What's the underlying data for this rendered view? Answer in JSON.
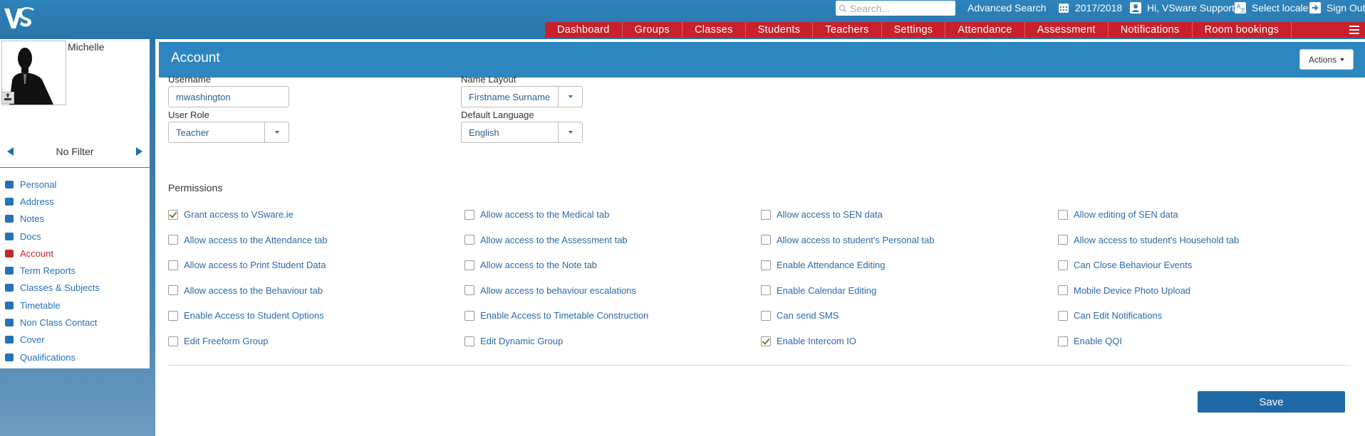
{
  "header": {
    "logo_text": "VS",
    "search_placeholder": "Search...",
    "advanced_search": "Advanced Search",
    "year": "2017/2018",
    "greeting": "Hi, VSware Support",
    "select_locale": "Select locale",
    "sign_out": "Sign Out"
  },
  "nav": [
    "Dashboard",
    "Groups",
    "Classes",
    "Students",
    "Teachers",
    "Settings",
    "Attendance",
    "Assessment",
    "Notifications",
    "Room bookings"
  ],
  "student": {
    "name": "Michelle"
  },
  "filter": {
    "label": "No Filter"
  },
  "sidebar": {
    "items": [
      {
        "label": "Personal",
        "icon": "person-icon"
      },
      {
        "label": "Address",
        "icon": "home-icon"
      },
      {
        "label": "Notes",
        "icon": "edit-icon"
      },
      {
        "label": "Docs",
        "icon": "file-icon"
      },
      {
        "label": "Account",
        "icon": "person-icon"
      },
      {
        "label": "Term Reports",
        "icon": "chart-icon"
      },
      {
        "label": "Classes & Subjects",
        "icon": "group-icon"
      },
      {
        "label": "Timetable",
        "icon": "calendar-icon"
      },
      {
        "label": "Non Class Contact",
        "icon": "calendar-icon"
      },
      {
        "label": "Cover",
        "icon": "person-icon"
      },
      {
        "label": "Qualifications",
        "icon": "file-icon"
      }
    ]
  },
  "account": {
    "title": "Account",
    "actions_label": "Actions",
    "username_label": "Username",
    "username_value": "mwashington",
    "name_layout_label": "Name Layout",
    "name_layout_value": "Firstname Surname",
    "user_role_label": "User Role",
    "user_role_value": "Teacher",
    "default_language_label": "Default Language",
    "default_language_value": "English",
    "permissions_label": "Permissions",
    "save_label": "Save"
  },
  "permissions": [
    [
      "Grant access to VSware.ie",
      "Allow access to the Medical tab",
      "Allow access to SEN data",
      "Allow editing of SEN data"
    ],
    [
      "Allow access to the Attendance tab",
      "Allow access to the Assessment tab",
      "Allow access to student's Personal tab",
      "Allow access to student's Household tab"
    ],
    [
      "Allow access to Print Student Data",
      "Allow access to the Note tab",
      "Enable Attendance Editing",
      "Can Close Behaviour Events"
    ],
    [
      "Allow access to the Behaviour tab",
      "Allow access to behaviour escalations",
      "Enable Calendar Editing",
      "Mobile Device Photo Upload"
    ],
    [
      "Enable Access to Student Options",
      "Enable Access to Timetable Construction",
      "Can send SMS",
      "Can Edit Notifications"
    ],
    [
      "Edit Freeform Group",
      "Edit Dynamic Group",
      "Enable Intercom IO",
      "Enable QQI"
    ]
  ],
  "permissions_checked": [
    [
      true,
      false,
      false,
      false
    ],
    [
      false,
      false,
      false,
      false
    ],
    [
      false,
      false,
      false,
      false
    ],
    [
      false,
      false,
      false,
      false
    ],
    [
      false,
      false,
      false,
      false
    ],
    [
      false,
      false,
      true,
      false
    ]
  ],
  "colors": {
    "header_blue": "#2e7fb5",
    "nav_red": "#c9202b",
    "panel_blue": "#2e86c1",
    "link_blue": "#2671b8",
    "active_red": "#c1272d",
    "save_blue": "#1f68a8"
  }
}
